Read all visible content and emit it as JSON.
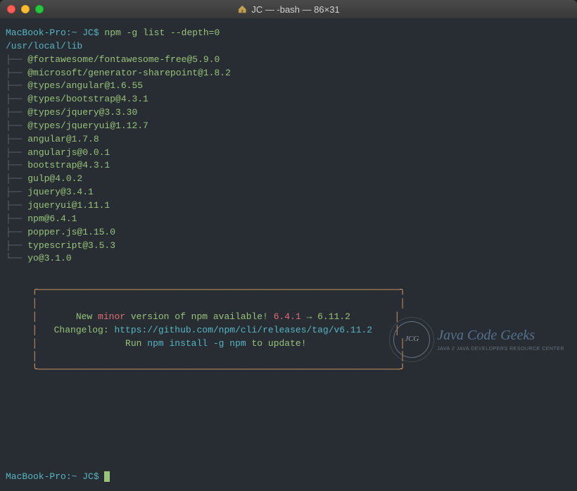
{
  "window": {
    "title": "JC — -bash — 86×31"
  },
  "prompt1": {
    "host": "MacBook-Pro:~ JC$",
    "cmd": " npm -g list --depth=0"
  },
  "listRoot": "/usr/local/lib",
  "packages": [
    "@fortawesome/fontawesome-free@5.9.0",
    "@microsoft/generator-sharepoint@1.8.2",
    "@types/angular@1.6.55",
    "@types/bootstrap@4.3.1",
    "@types/jquery@3.3.30",
    "@types/jqueryui@1.12.7",
    "angular@1.7.8",
    "angularjs@0.0.1",
    "bootstrap@4.3.1",
    "gulp@4.0.2",
    "jquery@3.4.1",
    "jqueryui@1.11.1",
    "npm@6.4.1",
    "popper.js@1.15.0",
    "typescript@3.5.3",
    "yo@3.1.0"
  ],
  "update": {
    "line1a": "New ",
    "line1b": "minor",
    "line1c": " version of npm available! ",
    "line1d": "6.4.1",
    "line1e": " → ",
    "line1f": "6.11.2",
    "line2a": "Changelog: ",
    "line2b": "https://github.com/npm/cli/releases/tag/v6.11.2",
    "line3a": "Run ",
    "line3b": "npm install -g npm",
    "line3c": " to update!"
  },
  "prompt2": {
    "host": "MacBook-Pro:~ JC$"
  },
  "watermark": {
    "circle": "JCG",
    "main": "Java Code Geeks",
    "sub": "JAVA 2 JAVA DEVELOPERS RESOURCE CENTER"
  },
  "tree": {
    "mid": "├── ",
    "last": "└── "
  }
}
